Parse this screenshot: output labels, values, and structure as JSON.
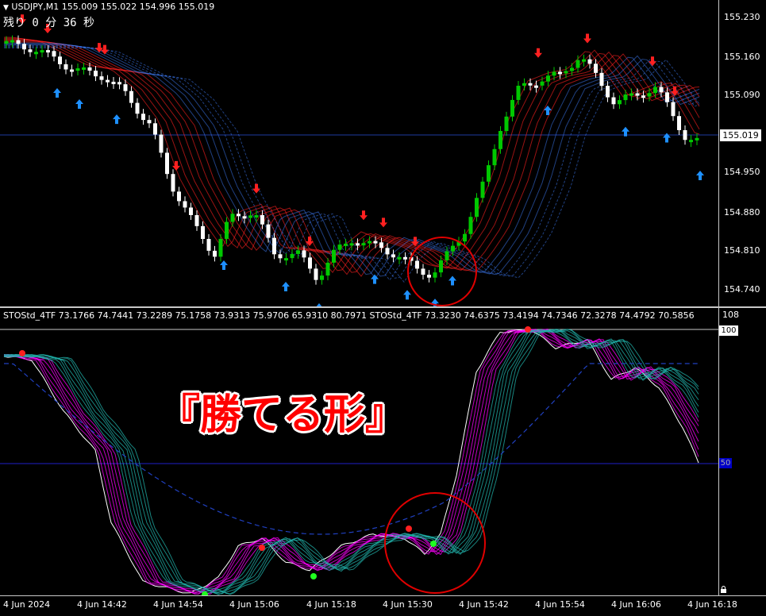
{
  "header": {
    "symbol_line": "USDJPY,M1  155.009 155.022 154.996 155.019",
    "countdown": "残り 0 分 36 秒"
  },
  "price_axis": {
    "ticks": [
      "155.230",
      "155.160",
      "155.090",
      "155.019",
      "154.950",
      "154.880",
      "154.810",
      "154.740"
    ],
    "current_price": "155.019"
  },
  "oscillator": {
    "header": "STOStd_4TF 73.1766 74.7441 73.2289 75.1758 73.9313 75.9706 65.9310 80.7971  STOStd_4TF 73.3230 74.6375 73.4194 74.7346 72.3278 74.4792 70.5856",
    "axis_max": "108",
    "level_100": "100",
    "level_50": "50"
  },
  "time_axis": {
    "labels": [
      "4 Jun 2024",
      "4 Jun 14:42",
      "4 Jun 14:54",
      "4 Jun 15:06",
      "4 Jun 15:18",
      "4 Jun 15:30",
      "4 Jun 15:42",
      "4 Jun 15:54",
      "4 Jun 16:06",
      "4 Jun 16:18"
    ]
  },
  "annotation": {
    "text": "『勝てる形』"
  },
  "colors": {
    "bull_candle": "#00c800",
    "bear_candle": "#ffffff",
    "up_arrow": "#1e90ff",
    "down_arrow": "#ff2020",
    "bear_ribbon": "#ff2020",
    "bull_ribbon": "#4080ff",
    "osc_magenta": "#ff00ff",
    "osc_teal": "#20b2aa",
    "circle": "#e00000"
  },
  "icons": {
    "lock": "lock-icon",
    "dropdown": "triangle-down-icon"
  }
}
